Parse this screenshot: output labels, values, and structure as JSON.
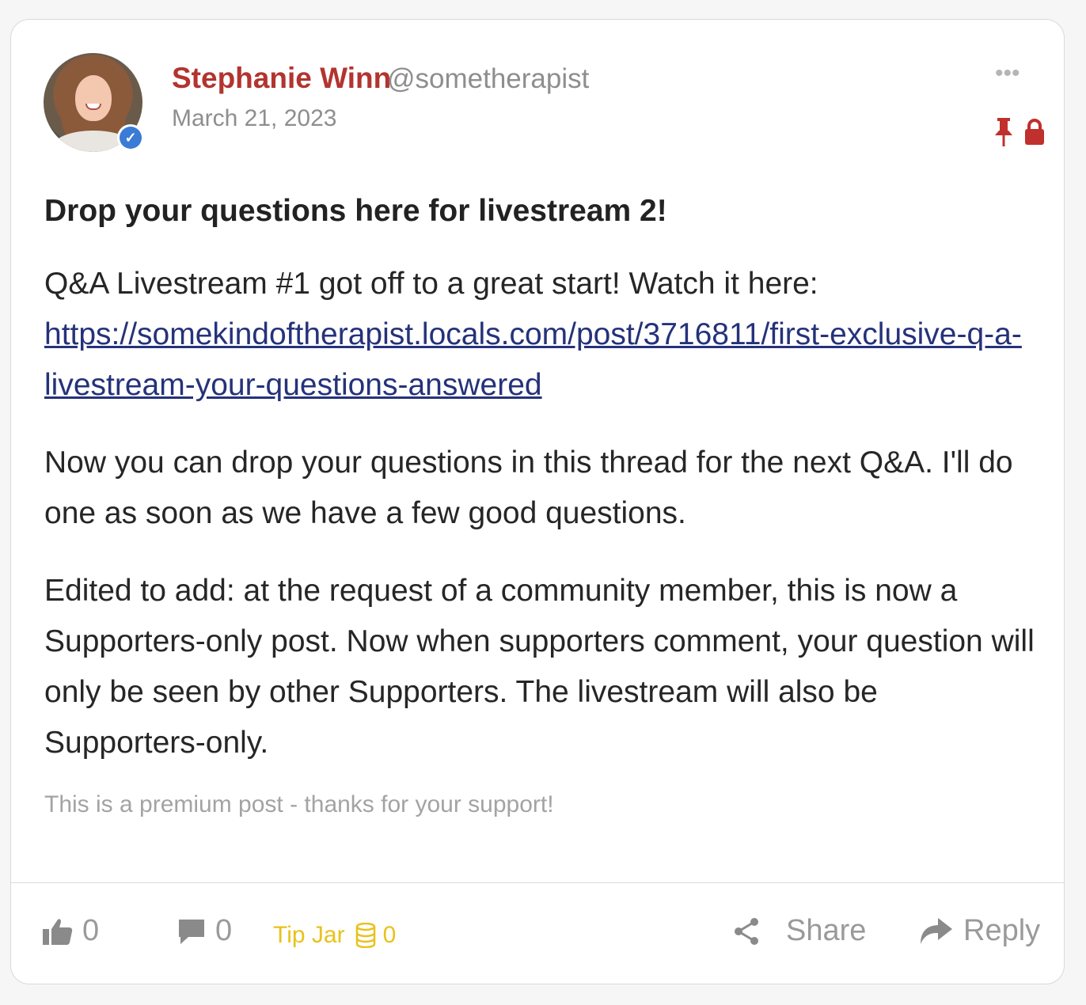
{
  "post": {
    "author_name": "Stephanie Winn",
    "author_handle": "@sometherapist",
    "date": "March 21, 2023",
    "more_menu_label": "•••",
    "title": "Drop your questions here for livestream 2!",
    "paragraph1_text": "Q&A Livestream #1 got off to a great start! Watch it here:",
    "paragraph1_link": "https://somekindoftherapist.locals.com/post/3716811/first-exclusive-q-a-livestream-your-questions-answered",
    "paragraph2": "Now you can drop your questions in this thread for the next Q&A. I'll do one as soon as we have a few good questions.",
    "paragraph3": "Edited to add: at the request of a community member, this is now a Supporters-only post. Now when supporters comment, your question will only be seen by other Supporters. The livestream will also be Supporters-only.",
    "premium_note": "This is a premium post - thanks for your support!"
  },
  "actions": {
    "like_count": "0",
    "comment_count": "0",
    "tip_label": "Tip Jar",
    "tip_count": "0",
    "share_label": "Share",
    "reply_label": "Reply"
  },
  "colors": {
    "author": "#b3342f",
    "link": "#25327a",
    "tip": "#e8c21b",
    "pin_lock": "#c0302c",
    "verified": "#3a7bd5"
  },
  "icons": [
    "verified-badge-icon",
    "more-dots-icon",
    "pin-icon",
    "lock-icon",
    "thumbs-up-icon",
    "comment-icon",
    "coins-icon",
    "share-icon",
    "reply-arrow-icon"
  ]
}
